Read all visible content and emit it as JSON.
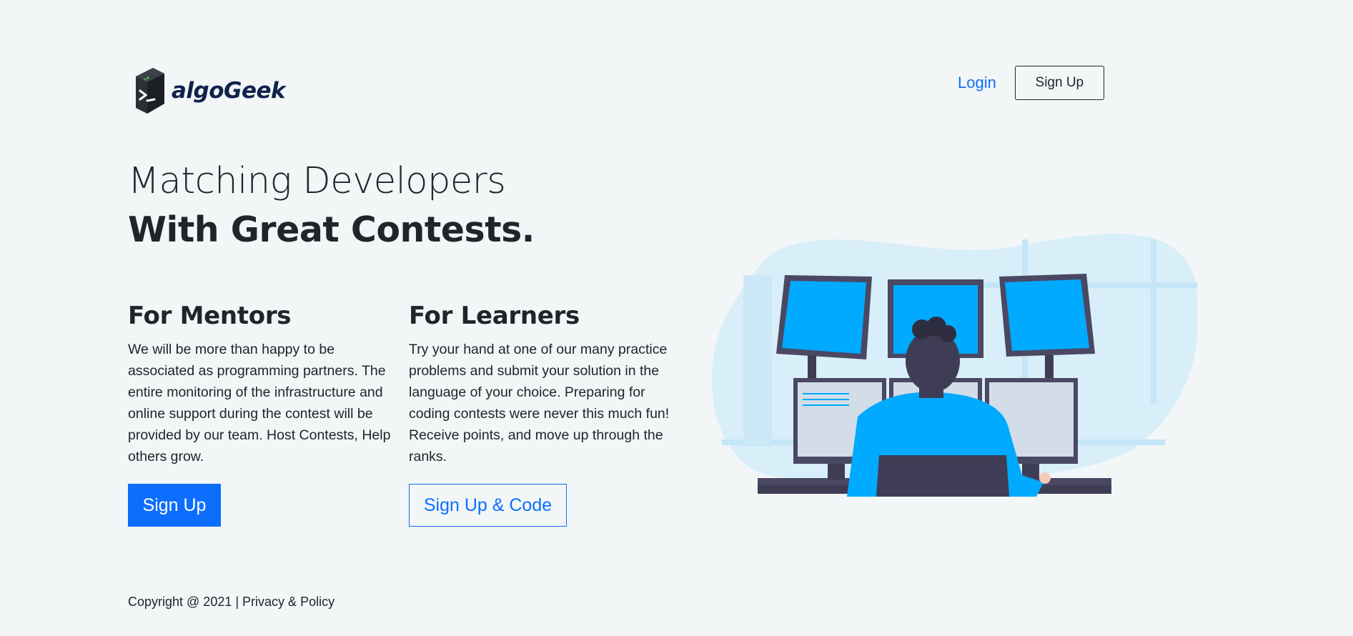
{
  "brand": {
    "name": "algoGeek"
  },
  "nav": {
    "login_label": "Login",
    "signup_label": "Sign Up"
  },
  "hero": {
    "line1": "Matching Developers",
    "line2": "With Great Contests."
  },
  "mentors": {
    "title": "For Mentors",
    "description": "We will be more than happy to be associated as programming partners. The entire monitoring of the infrastructure and online support during the contest will be provided by our team. Host Contests, Help others grow.",
    "button_label": "Sign Up"
  },
  "learners": {
    "title": "For Learners",
    "description": "Try your hand at one of our many practice problems and submit your solution in the language of your choice. Preparing for coding contests were never this much fun! Receive points, and move up through the ranks.",
    "button_label": "Sign Up & Code"
  },
  "footer": {
    "copyright": "Copyright @ 2021 |",
    "privacy_label": "Privacy & Policy"
  },
  "colors": {
    "accent": "#0d6efd",
    "background": "#f2f6f7",
    "screen": "#00aaff",
    "brand_text": "#10224a"
  },
  "icons": {
    "logo": "terminal-cube-icon",
    "illustration": "developer-at-monitors-illustration"
  }
}
